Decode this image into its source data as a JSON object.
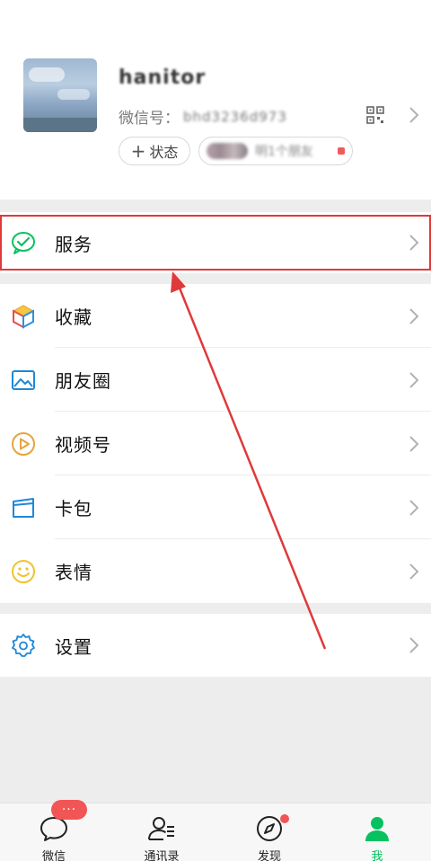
{
  "profile": {
    "nickname": "hanitor",
    "wxid_label": "微信号：",
    "wxid_value": "bhd3236d973",
    "status_label": "状态",
    "friends_text": "明1个朋友"
  },
  "menu": {
    "service": "服务",
    "favorites": "收藏",
    "moments": "朋友圈",
    "channels": "视频号",
    "cards": "卡包",
    "stickers": "表情",
    "settings": "设置"
  },
  "tabbar": {
    "chats": "微信",
    "contacts": "通讯录",
    "discover": "发现",
    "me": "我",
    "chats_badge": "···"
  },
  "colors": {
    "accent_green": "#07c160",
    "annotation_red": "#e0393a",
    "badge_red": "#f25555"
  }
}
